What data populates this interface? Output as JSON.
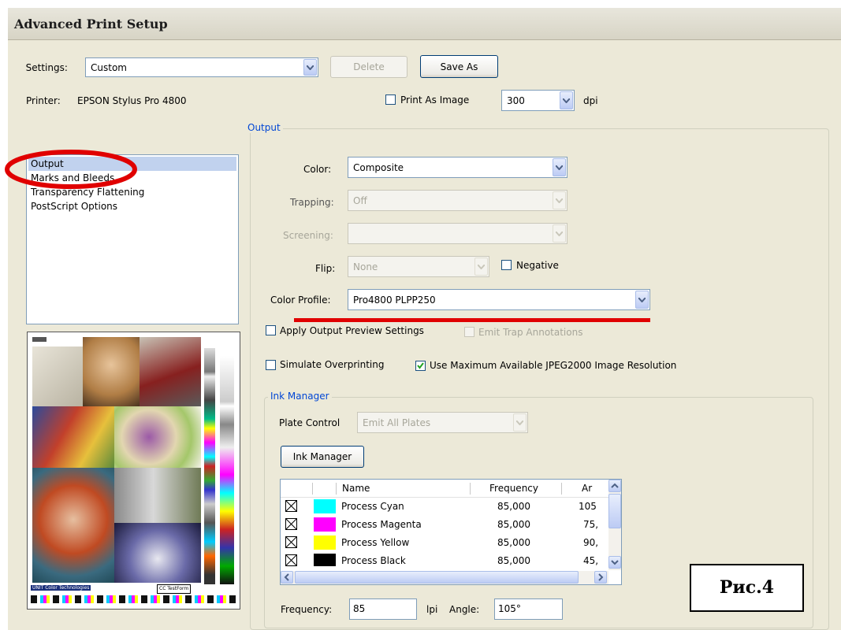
{
  "window": {
    "title": "Advanced Print Setup"
  },
  "settings": {
    "label": "Settings:",
    "value": "Custom",
    "delete_label": "Delete",
    "save_as_label": "Save As"
  },
  "printer": {
    "label": "Printer:",
    "value": "EPSON Stylus Pro 4800",
    "print_as_image_label": "Print As Image",
    "dpi_value": "300",
    "dpi_unit": "dpi"
  },
  "sidebar": {
    "items": [
      {
        "label": "Output"
      },
      {
        "label": "Marks and Bleeds"
      },
      {
        "label": "Transparency Flattening"
      },
      {
        "label": "PostScript Options"
      }
    ]
  },
  "output": {
    "legend": "Output",
    "color_label": "Color:",
    "color_value": "Composite",
    "trapping_label": "Trapping:",
    "trapping_value": "Off",
    "screening_label": "Screening:",
    "screening_value": "",
    "flip_label": "Flip:",
    "flip_value": "None",
    "negative_label": "Negative",
    "color_profile_label": "Color Profile:",
    "color_profile_value": "Pro4800 PLPP250",
    "apply_preview_label": "Apply Output Preview Settings",
    "emit_trap_label": "Emit Trap Annotations",
    "simulate_overprint_label": "Simulate Overprinting",
    "use_max_jpeg_label": "Use Maximum Available JPEG2000 Image Resolution"
  },
  "ink_manager": {
    "legend": "Ink Manager",
    "plate_control_label": "Plate Control",
    "plate_control_value": "Emit All Plates",
    "button_label": "Ink Manager",
    "columns": [
      "Name",
      "Frequency",
      "Ar"
    ],
    "rows": [
      {
        "name": "Process Cyan",
        "frequency": "85,000",
        "angle": "105",
        "color": "#00ffff"
      },
      {
        "name": "Process Magenta",
        "frequency": "85,000",
        "angle": "75,",
        "color": "#ff00ff"
      },
      {
        "name": "Process Yellow",
        "frequency": "85,000",
        "angle": "90,",
        "color": "#ffff00"
      },
      {
        "name": "Process Black",
        "frequency": "85,000",
        "angle": "45,",
        "color": "#000000"
      }
    ],
    "frequency_label": "Frequency:",
    "frequency_value": "85",
    "lpi_label": "lpi",
    "angle_label": "Angle:",
    "angle_value": "105°"
  },
  "preview": {
    "footer_left": "UNIT Color Technologies",
    "footer_right": "CC TestForm"
  },
  "figure_label": "Рис.4",
  "annotation_color": "#e00000"
}
